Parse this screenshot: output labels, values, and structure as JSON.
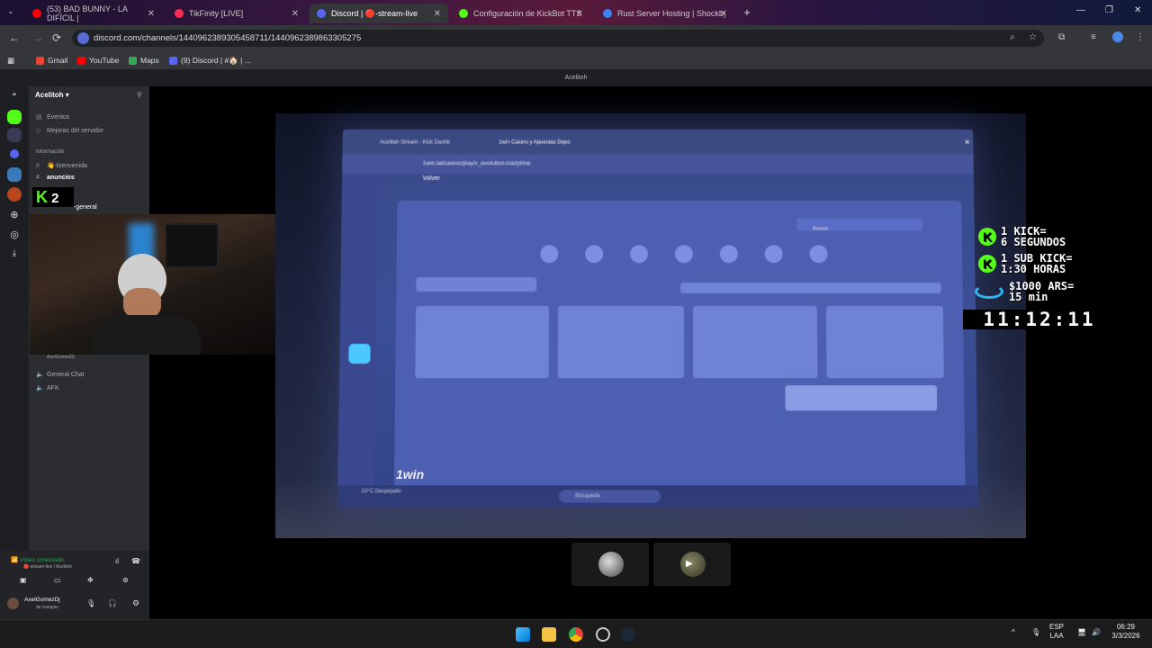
{
  "browser": {
    "tabs": [
      {
        "label": "(53) BAD BUNNY - LA DIFÍCIL |",
        "color": "#ff0000"
      },
      {
        "label": "TikFinity [LIVE]",
        "color": "#ff2d55"
      },
      {
        "label": "Discord | 🔴-stream-live",
        "color": "#5865f2"
      },
      {
        "label": "Configuración de KickBot TTS",
        "color": "#53fc18"
      },
      {
        "label": "Rust Server Hosting | Shockbyte",
        "color": "#3b82f6"
      }
    ],
    "url": "discord.com/channels/1440962389305458711/1440962389863305275",
    "bookmarks": [
      {
        "label": "Gmail",
        "color": "#ea4335"
      },
      {
        "label": "YouTube",
        "color": "#ff0000"
      },
      {
        "label": "Maps",
        "color": "#34a853"
      },
      {
        "label": "(9) Discord | #🏠 | ...",
        "color": "#5865f2"
      }
    ]
  },
  "discord": {
    "window_title": "Acelitoh",
    "server_name": "Acelitoh",
    "channels": [
      {
        "icon": "calendar-icon",
        "label": "Eventos"
      },
      {
        "icon": "boost-icon",
        "label": "Mejoras del servidor"
      },
      {
        "icon": "category",
        "label": "Información"
      },
      {
        "icon": "hash-icon",
        "label": "👋-bienvenida"
      },
      {
        "icon": "hash-icon",
        "label": "anuncios"
      },
      {
        "icon": "hash-icon",
        "label": "-general"
      },
      {
        "icon": "voice-icon",
        "label": "AxelGomezDj"
      },
      {
        "icon": "voice-icon",
        "label": "General Chat"
      },
      {
        "icon": "voice-icon",
        "label": "AFK"
      }
    ],
    "voice_status": "Vídeo conectado",
    "voice_channel": "🔴-stream-live / Acelitoh",
    "username": "AxelGomezDj",
    "user_status": "de tranquis"
  },
  "overlay": {
    "k2": "2",
    "rules": [
      {
        "line1": "1 KICK=",
        "line2": "6 SEGUNDOS"
      },
      {
        "line1": "1 SUB KICK=",
        "line2": "1:30 HORAS"
      },
      {
        "line1": "$1000 ARS=",
        "line2": "15 min"
      }
    ],
    "timer": "11:12:11"
  },
  "stream_screen": {
    "tab1": "Acelitoh Stream - Kick Dashb",
    "tab2": "1win Casino y Apuestas Depo",
    "url": "1win.lat/casino/play/v_evolution:crazytime",
    "back": "Volver",
    "search": "Buscar",
    "brand": "1win",
    "weather": "10°C Despejado",
    "taskbar_search": "Búsqueda"
  },
  "taskbar": {
    "lang": "ESP",
    "layout": "LAA",
    "time": "06:29",
    "date": "3/3/2026"
  }
}
